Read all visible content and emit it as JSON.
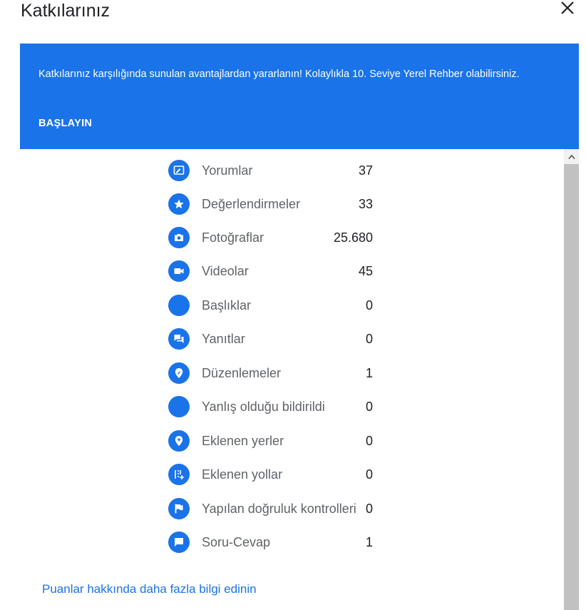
{
  "dialog": {
    "title": "Katkılarınız"
  },
  "banner": {
    "text": "Katkılarınız karşılığında sunulan avantajlardan yararlanın! Kolaylıkla 10. Seviye Yerel Rehber olabilirsiniz.",
    "button_label": "BAŞLAYIN",
    "color": "#1a73e8"
  },
  "stats": [
    {
      "icon": "review-icon",
      "label": "Yorumlar",
      "value": "37"
    },
    {
      "icon": "star-icon",
      "label": "Değerlendirmeler",
      "value": "33"
    },
    {
      "icon": "camera-icon",
      "label": "Fotoğraflar",
      "value": "25.680"
    },
    {
      "icon": "video-icon",
      "label": "Videolar",
      "value": "45"
    },
    {
      "icon": "caption-icon",
      "label": "Başlıklar",
      "value": "0"
    },
    {
      "icon": "answers-icon",
      "label": "Yanıtlar",
      "value": "0"
    },
    {
      "icon": "edit-place-icon",
      "label": "Düzenlemeler",
      "value": "1"
    },
    {
      "icon": "report-icon",
      "label": "Yanlış olduğu bildirildi",
      "value": "0"
    },
    {
      "icon": "add-place-icon",
      "label": "Eklenen yerler",
      "value": "0"
    },
    {
      "icon": "add-road-icon",
      "label": "Eklenen yollar",
      "value": "0"
    },
    {
      "icon": "flag-icon",
      "label": "Yapılan doğruluk kontrolleri",
      "value": "0"
    },
    {
      "icon": "chat-icon",
      "label": "Soru-Cevap",
      "value": "1"
    }
  ],
  "footer": {
    "link_text": "Puanlar hakkında daha fazla bilgi edinin"
  }
}
